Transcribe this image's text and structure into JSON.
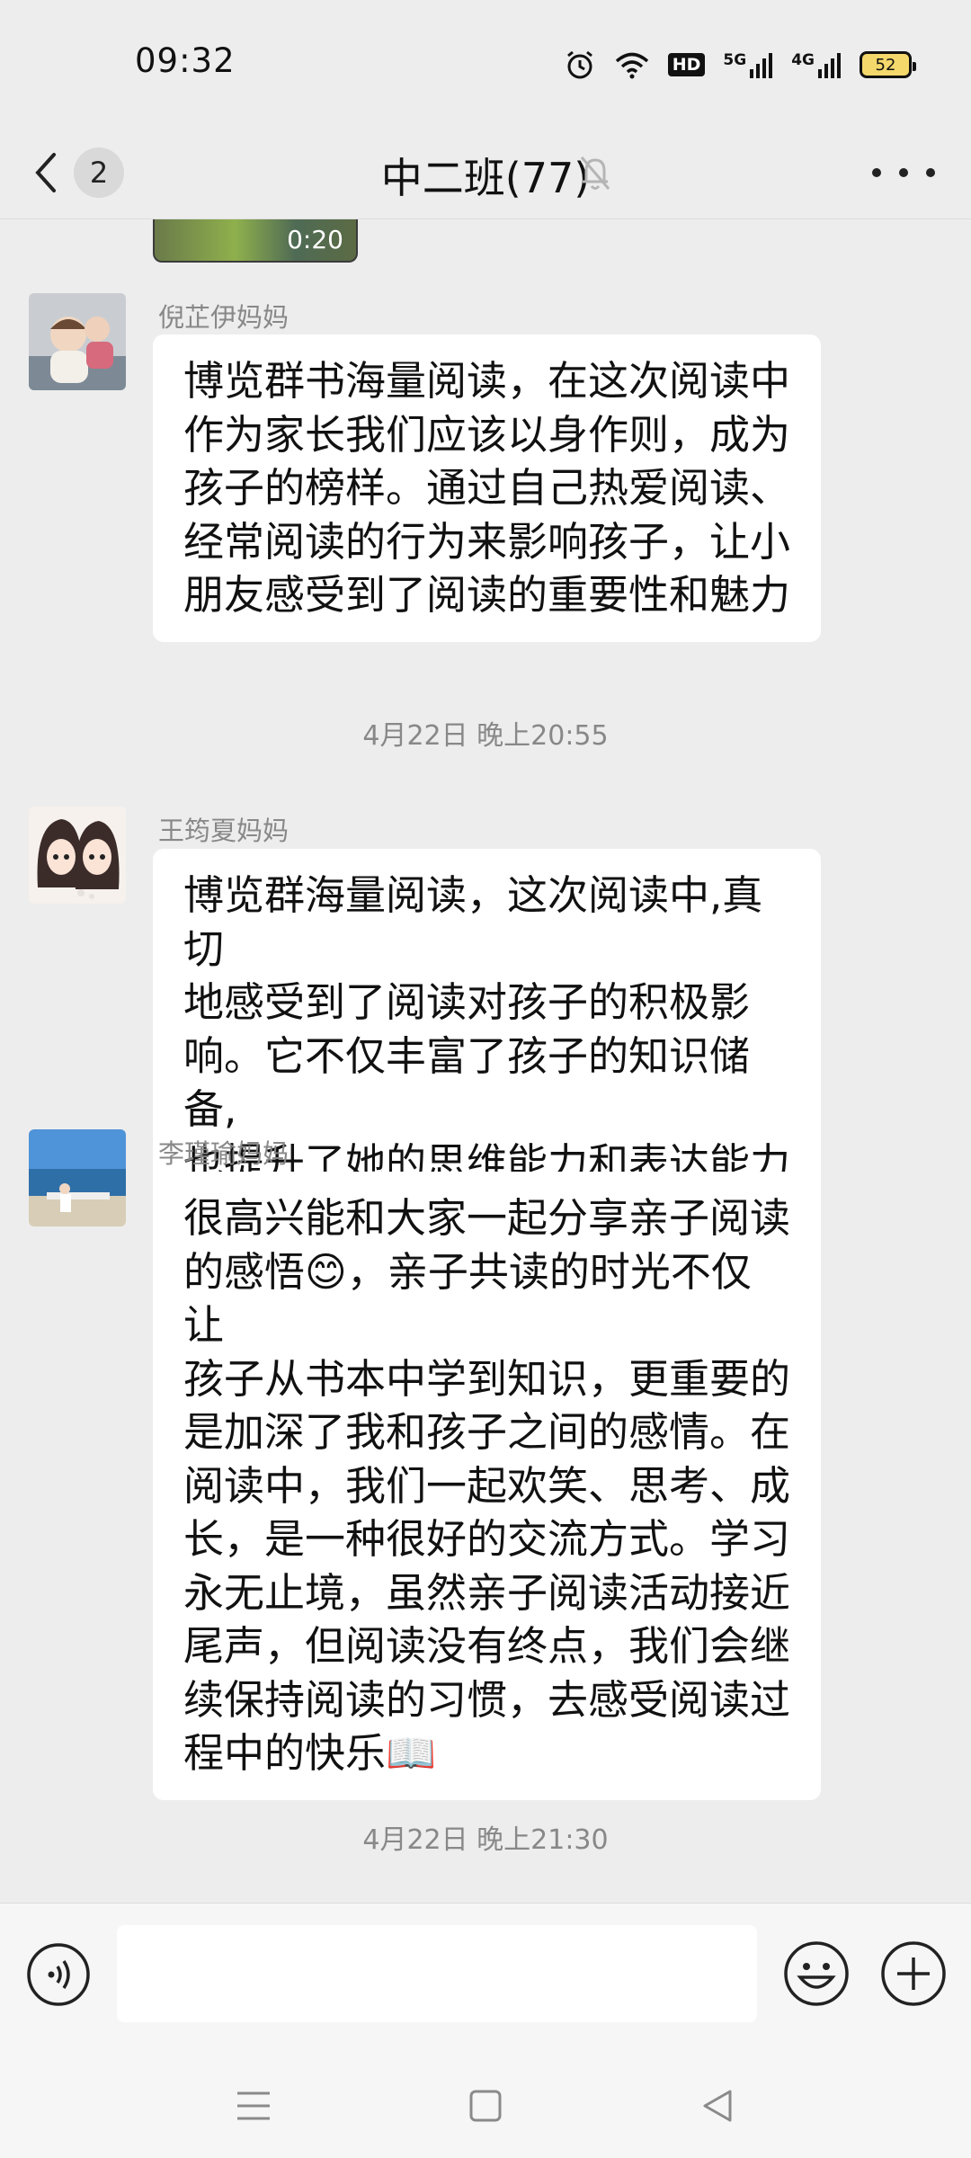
{
  "status_bar": {
    "time": "09:32",
    "hd": "HD",
    "sig1": "5G",
    "sig2": "4G",
    "battery": "52"
  },
  "header": {
    "unread_count": "2",
    "title": "中二班(77)"
  },
  "video": {
    "duration": "0:20"
  },
  "messages": [
    {
      "sender": "倪芷伊妈妈",
      "text": "博览群书海量阅读，在这次阅读中\n作为家长我们应该以身作则，成为\n孩子的榜样。通过自己热爱阅读、\n经常阅读的行为来影响孩子，让小\n朋友感受到了阅读的重要性和魅力"
    },
    {
      "sender": "王筠夏妈妈",
      "text": "博览群海量阅读，这次阅读中,真切\n地感受到了阅读对孩子的积极影\n响。它不仅丰富了孩子的知识储备,\n也提升了她的思维能力和表达能力"
    },
    {
      "sender": "李瑾瑜妈妈",
      "text": "很高兴能和大家一起分享亲子阅读\n的感悟😊，亲子共读的时光不仅让\n孩子从书本中学到知识，更重要的\n是加深了我和孩子之间的感情。在\n阅读中，我们一起欢笑、思考、成\n长，是一种很好的交流方式。学习\n永无止境，虽然亲子阅读活动接近\n尾声，但阅读没有终点，我们会继\n续保持阅读的习惯，去感受阅读过\n程中的快乐📖"
    }
  ],
  "timestamps": [
    "4月22日 晚上20:55",
    "4月22日 晚上21:30"
  ],
  "colors": {
    "background": "#ededed",
    "bubble": "#ffffff",
    "meta_text": "#888888"
  }
}
